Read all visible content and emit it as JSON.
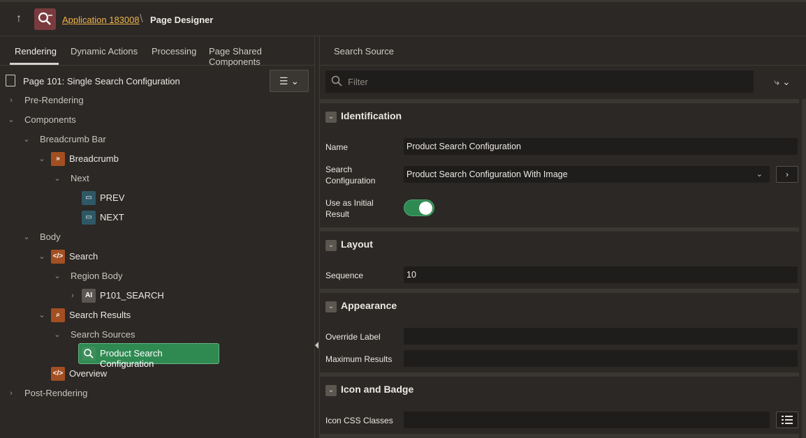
{
  "topbar": {
    "app_link": "Application 183008",
    "separator": "\\",
    "page": "Page Designer"
  },
  "left_tabs": [
    "Rendering",
    "Dynamic Actions",
    "Processing",
    "Page Shared Components"
  ],
  "page_title": "Page 101: Single Search Configuration",
  "tree": {
    "pre_rendering": "Pre-Rendering",
    "components": "Components",
    "breadcrumb_bar": "Breadcrumb Bar",
    "breadcrumb": "Breadcrumb",
    "next_group": "Next",
    "prev": "PREV",
    "next": "NEXT",
    "body": "Body",
    "search": "Search",
    "region_body": "Region Body",
    "p101_search": "P101_SEARCH",
    "search_results": "Search Results",
    "search_sources": "Search Sources",
    "product_search_config": "Product Search Configuration",
    "overview": "Overview",
    "post_rendering": "Post-Rendering"
  },
  "right_panel": {
    "header": "Search Source",
    "filter_placeholder": "Filter",
    "sections": {
      "identification": "Identification",
      "layout": "Layout",
      "appearance": "Appearance",
      "icon_badge": "Icon and Badge"
    },
    "props": {
      "name_label": "Name",
      "name_value": "Product Search Configuration",
      "search_config_label": "Search Configuration",
      "search_config_value": "Product Search Configuration With Image",
      "use_initial_label": "Use as Initial Result",
      "use_initial_value": true,
      "sequence_label": "Sequence",
      "sequence_value": "10",
      "override_label": "Override Label",
      "override_value": "",
      "max_results_label": "Maximum Results",
      "max_results_value": "",
      "icon_css_label": "Icon CSS Classes",
      "icon_css_value": ""
    }
  },
  "colors": {
    "background": "#2b2825",
    "accent_link": "#f0b44c",
    "selected_green": "#2f8a52",
    "icon_orange": "#a34f22",
    "field_bg": "#1f1d1b"
  }
}
